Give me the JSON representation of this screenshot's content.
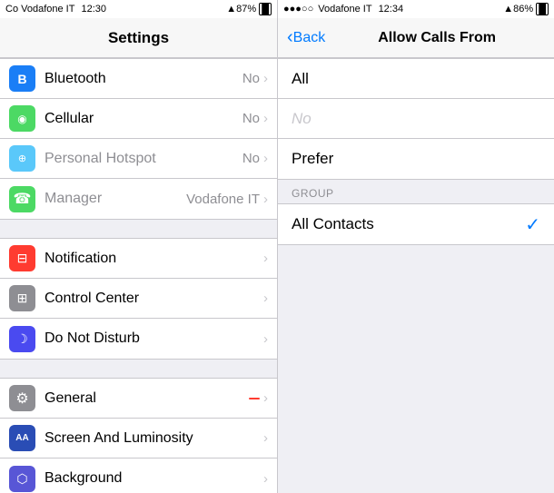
{
  "left": {
    "status": {
      "carrier": "Co Vodafone IT",
      "time": "12:30",
      "signal": "▲87%",
      "battery": "87%"
    },
    "nav_title": "Settings",
    "groups": [
      {
        "items": [
          {
            "id": "bluetooth",
            "icon_class": "icon-blue",
            "icon": "B",
            "label": "Bluetooth",
            "value": "No",
            "chevron": true
          },
          {
            "id": "cellular",
            "icon_class": "icon-green2",
            "icon": "◎",
            "label": "Cellular",
            "value": "No",
            "chevron": true
          },
          {
            "id": "hotspot",
            "icon_class": "icon-teal",
            "icon": "⊕",
            "label": "Personal Hotspot",
            "value": "No",
            "chevron": true
          },
          {
            "id": "manager",
            "icon_class": "icon-green",
            "icon": "☎",
            "label": "Manager",
            "value": "Vodafone IT",
            "chevron": true
          }
        ]
      },
      {
        "items": [
          {
            "id": "notifications",
            "icon_class": "icon-red",
            "icon": "⊡",
            "label": "Notification",
            "value": "",
            "chevron": true
          },
          {
            "id": "control-center",
            "icon_class": "icon-gray",
            "icon": "⊞",
            "label": "Control Center",
            "value": "",
            "chevron": true
          },
          {
            "id": "do-not-disturb",
            "icon_class": "icon-moon",
            "icon": "☽",
            "label": "Do Not Disturb",
            "value": "",
            "chevron": true
          }
        ]
      },
      {
        "items": [
          {
            "id": "general",
            "icon_class": "icon-gray",
            "icon": "⚙",
            "label": "General",
            "value": "",
            "chevron": true
          },
          {
            "id": "screen",
            "icon_class": "icon-dark-blue",
            "icon": "AA",
            "label": "Screen And Luminosity",
            "value": "",
            "chevron": true
          },
          {
            "id": "background",
            "icon_class": "icon-purple",
            "icon": "⬡",
            "label": "Background",
            "value": "",
            "chevron": true
          }
        ]
      }
    ]
  },
  "right": {
    "status": {
      "carrier": "●●●○○ Vodafone IT",
      "time": "12:34",
      "signal": "▲86%",
      "battery": "86%"
    },
    "back_label": "Back",
    "nav_title": "Allow Calls From",
    "groups": [
      {
        "items": [
          {
            "id": "all",
            "label": "All",
            "selected": false
          },
          {
            "id": "no",
            "label": "No",
            "selected": false,
            "gray": true
          },
          {
            "id": "prefer",
            "label": "Prefer",
            "selected": false
          }
        ]
      }
    ],
    "section_header": "GROUP",
    "group_items": [
      {
        "id": "all-contacts",
        "label": "All Contacts",
        "selected": true
      }
    ]
  }
}
